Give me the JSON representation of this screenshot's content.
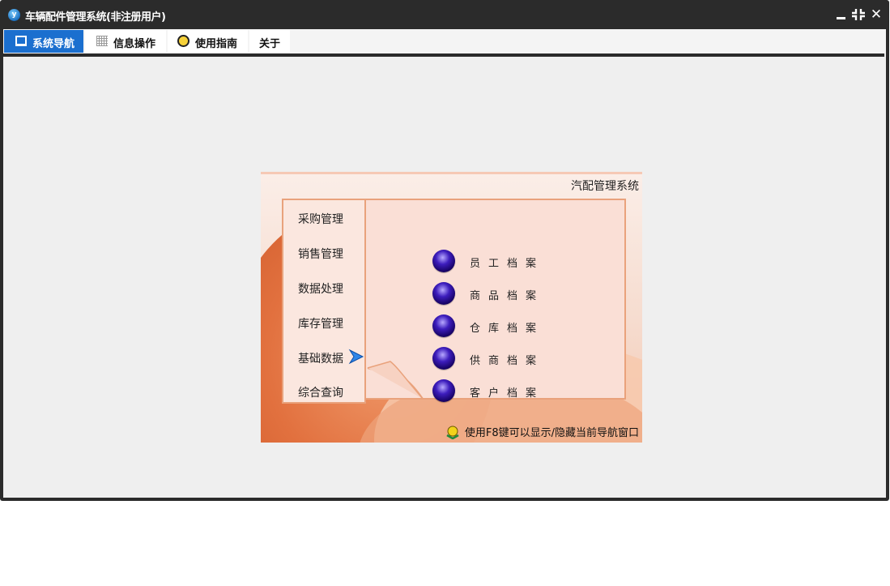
{
  "window": {
    "title": "车辆配件管理系统(非注册用户)",
    "app_icon": "app-logo-icon",
    "controls": [
      "minimize-icon",
      "restore-icon",
      "close-icon"
    ]
  },
  "tabs": [
    {
      "label": "系统导航",
      "icon": "monitor-icon",
      "active": true
    },
    {
      "label": "信息操作",
      "icon": "grid-icon",
      "active": false
    },
    {
      "label": "使用指南",
      "icon": "guide-icon",
      "active": false
    },
    {
      "label": "关于",
      "active": false
    }
  ],
  "nav": {
    "header": "汽配管理系统",
    "menu": [
      {
        "label": "采购管理"
      },
      {
        "label": "销售管理"
      },
      {
        "label": "数据处理"
      },
      {
        "label": "库存管理"
      },
      {
        "label": "基础数据",
        "selected": true
      },
      {
        "label": "综合查询"
      }
    ],
    "records": [
      {
        "label": "员工档案"
      },
      {
        "label": "商品档案"
      },
      {
        "label": "仓库档案"
      },
      {
        "label": "供商档案"
      },
      {
        "label": "客户档案"
      }
    ],
    "hint": "使用F8键可以显示/隐藏当前导航窗口"
  },
  "colors": {
    "titlebar": "#2b2b2b",
    "active_tab": "#1b6fcf",
    "client_bg": "#efefef",
    "accent_orange": "#e2713f"
  }
}
